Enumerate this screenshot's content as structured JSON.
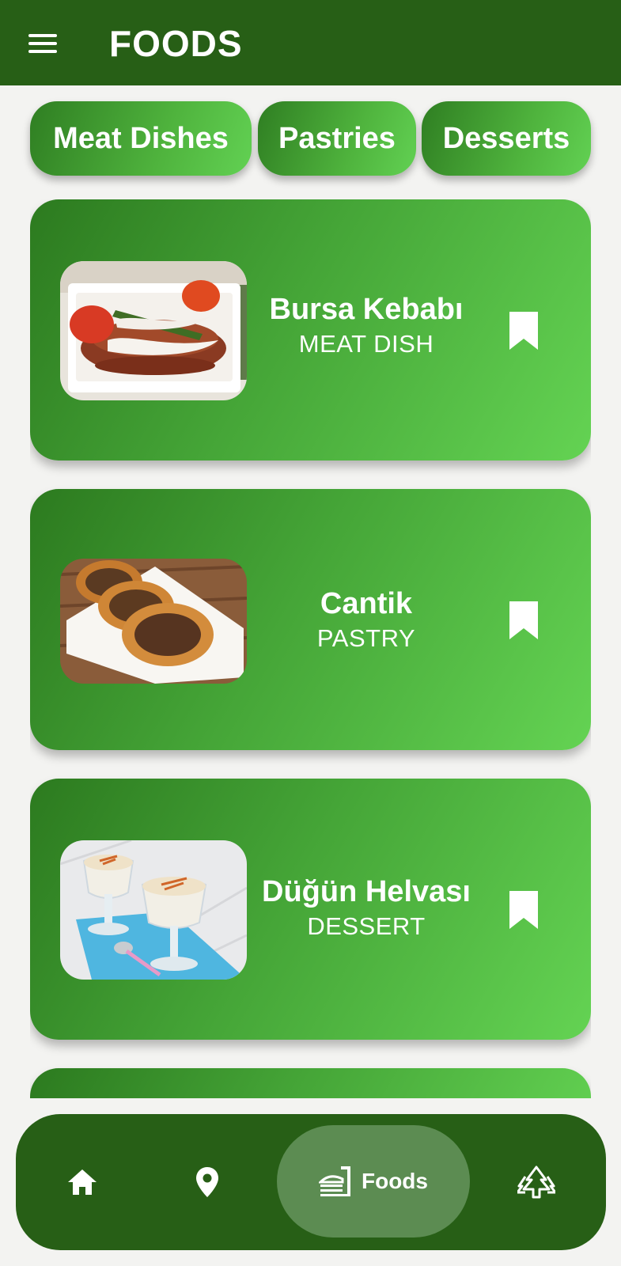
{
  "app_bar": {
    "title": "FOODS",
    "menu_icon": "hamburger-menu-icon"
  },
  "categories": [
    {
      "label": "Meat Dishes"
    },
    {
      "label": "Pastries"
    },
    {
      "label": "Desserts"
    }
  ],
  "foods": [
    {
      "name": "Bursa Kebabı",
      "type": "MEAT DISH",
      "bookmark_icon": "bookmark-icon"
    },
    {
      "name": "Cantik",
      "type": "PASTRY",
      "bookmark_icon": "bookmark-icon"
    },
    {
      "name": "Düğün Helvası",
      "type": "DESSERT",
      "bookmark_icon": "bookmark-icon"
    }
  ],
  "bottom_nav": {
    "items": [
      {
        "icon": "home-icon",
        "label": ""
      },
      {
        "icon": "location-pin-icon",
        "label": ""
      },
      {
        "icon": "food-tray-icon",
        "label": "Foods",
        "selected": true
      },
      {
        "icon": "trees-icon",
        "label": ""
      }
    ]
  },
  "colors": {
    "app_bar": "#275f16",
    "card_gradient_start": "#2c7a1f",
    "card_gradient_end": "#64d353",
    "background": "#f3f3f1",
    "nav_selected": "#5c8c52"
  }
}
